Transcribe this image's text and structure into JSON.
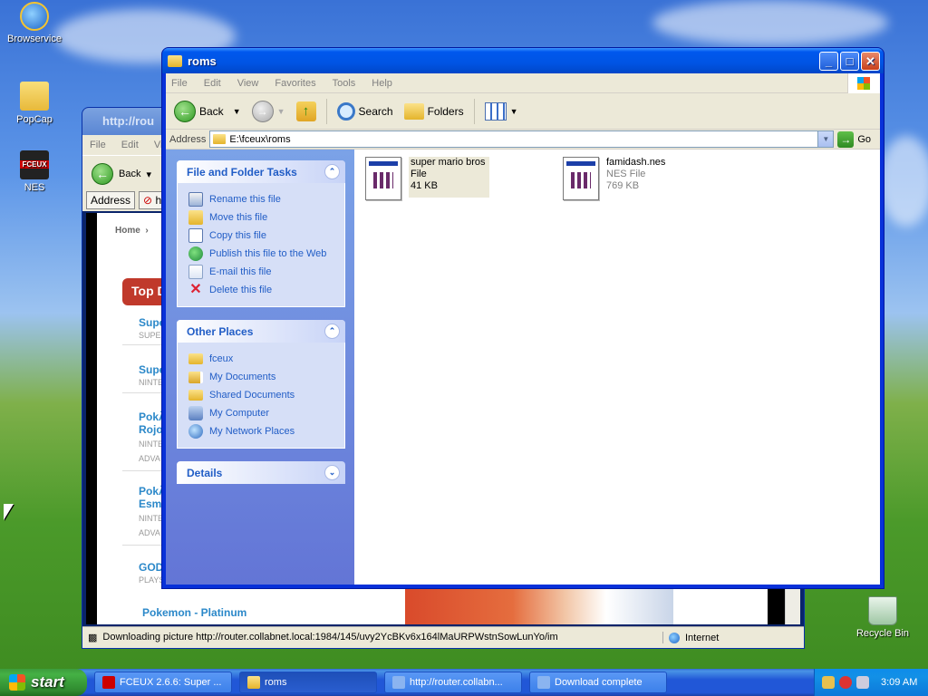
{
  "desktop": {
    "icons": [
      {
        "label": "Browservice",
        "icon": "internet-explorer-icon"
      },
      {
        "label": "PopCap",
        "icon": "folder-icon"
      },
      {
        "label": "NES",
        "icon": "fceux-icon"
      },
      {
        "label": "Recycle Bin",
        "icon": "recycle-bin-icon"
      }
    ]
  },
  "ie_window": {
    "title": "http://rou",
    "menu": [
      "File",
      "Edit",
      "View"
    ],
    "back_label": "Back",
    "address_label": "Address",
    "address_value": "h",
    "breadcrumb": "Home",
    "banner": "Top D",
    "games": [
      {
        "title": "Supe",
        "sub": "SUPER"
      },
      {
        "title": "Supe",
        "sub": "NINTE"
      },
      {
        "title": "PokÃ",
        "title2": "Rojo",
        "sub": "NINTE",
        "sub2": "ADVA"
      },
      {
        "title": "PokÃ",
        "title2": "Esme",
        "sub": "NINTE",
        "sub2": "ADVA"
      },
      {
        "title": "GOD",
        "sub": "PLAYS"
      }
    ],
    "featured_link": "Pokemon - Platinum",
    "status_text": "Downloading picture http://router.collabnet.local:1984/145/uvy2YcBKv6x164lMaURPWstnSowLunYo/im",
    "zone_text": "Internet"
  },
  "explorer": {
    "title": "roms",
    "menu": [
      "File",
      "Edit",
      "View",
      "Favorites",
      "Tools",
      "Help"
    ],
    "toolbar": {
      "back_label": "Back",
      "search_label": "Search",
      "folders_label": "Folders"
    },
    "address_label": "Address",
    "address_value": "E:\\fceux\\roms",
    "go_label": "Go",
    "file_tasks": {
      "heading": "File and Folder Tasks",
      "items": [
        "Rename this file",
        "Move this file",
        "Copy this file",
        "Publish this file to the Web",
        "E-mail this file",
        "Delete this file"
      ]
    },
    "other_places": {
      "heading": "Other Places",
      "items": [
        "fceux",
        "My Documents",
        "Shared Documents",
        "My Computer",
        "My Network Places"
      ]
    },
    "details": {
      "heading": "Details"
    },
    "files": [
      {
        "name": "super mario bros",
        "type": "File",
        "size": "41 KB",
        "selected": true
      },
      {
        "name": "famidash.nes",
        "type": "NES File",
        "size": "769 KB",
        "selected": false
      }
    ]
  },
  "taskbar": {
    "start_label": "start",
    "buttons": [
      {
        "label": "FCEUX 2.6.6: Super ...",
        "active": false
      },
      {
        "label": "roms",
        "active": true
      },
      {
        "label": "http://router.collabn...",
        "active": false
      },
      {
        "label": "Download complete",
        "active": false
      }
    ],
    "clock": "3:09 AM"
  }
}
